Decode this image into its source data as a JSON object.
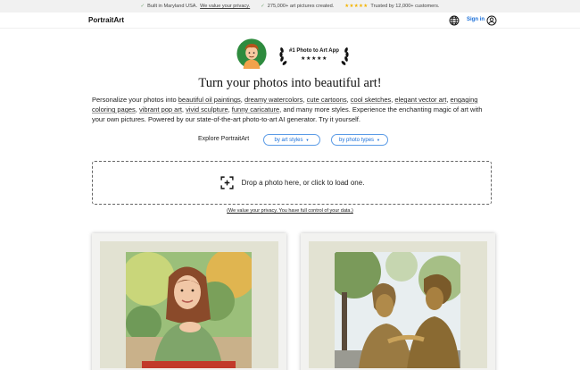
{
  "topbar": {
    "item1_text": "Built in Maryland USA.",
    "item1_link": "We value your privacy.",
    "item2_text": "275,000+ art pictures created.",
    "item3_stars": "★★★★★",
    "item3_text": "Trusted by 12,000+ customers."
  },
  "nav": {
    "brand": "PortraitArt",
    "signin": "Sign in"
  },
  "badge": {
    "title": "#1 Photo to Art App",
    "stars": "★★★★★"
  },
  "hero": {
    "headline": "Turn your photos into beautiful art!",
    "desc_intro": "Personalize your photos into ",
    "styles": [
      "beautiful oil paintings",
      "dreamy watercolors",
      "cute cartoons",
      "cool sketches",
      "elegant vector art",
      "engaging coloring pages",
      "vibrant pop art",
      "vivid sculpture",
      "funny caricature"
    ],
    "desc_outro": ", and many more styles. Experience the enchanting magic of art with your own pictures. Powered by our state-of-the-art photo-to-art AI generator. Try it yourself."
  },
  "explore": {
    "label": "Explore PortraitArt",
    "by_styles": "by art styles",
    "by_types": "by photo types"
  },
  "upload": {
    "drop_text": "Drop a photo here, or click to load one.",
    "privacy_note": "(We value your privacy. You have full control of your data.)"
  },
  "icons": {
    "check": "✓",
    "caret": "▼"
  },
  "colors": {
    "accent": "#1a6fd8",
    "topbar_bg": "#f1f1f1",
    "mat": "#e2e2d2"
  }
}
